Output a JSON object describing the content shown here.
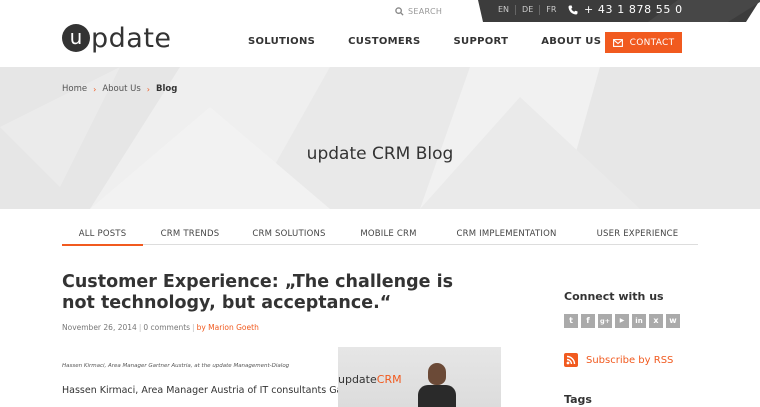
{
  "header": {
    "logo_letter": "u",
    "logo_rest": "pdate",
    "search_label": "SEARCH",
    "languages": [
      "EN",
      "DE",
      "FR"
    ],
    "phone": "+ 43 1 878 55 0",
    "nav": [
      "SOLUTIONS",
      "CUSTOMERS",
      "SUPPORT",
      "ABOUT US"
    ],
    "contact_label": "CONTACT"
  },
  "hero": {
    "breadcrumb": [
      "Home",
      "About Us",
      "Blog"
    ],
    "title": "update CRM Blog"
  },
  "tabs": [
    "ALL POSTS",
    "CRM TRENDS",
    "CRM SOLUTIONS",
    "MOBILE CRM",
    "CRM IMPLEMENTATION",
    "USER EXPERIENCE"
  ],
  "article": {
    "title": "Customer Experience: „The challenge is not technology, but acceptance.“",
    "date": "November 26, 2014",
    "comments": "0 comments",
    "author": "by Marion Goeth",
    "caption": "Hassen Kirmaci, Area Manager Gartner Austria, at the update Management-Dialog",
    "excerpt": "Hassen Kirmaci, Area Manager Austria of IT consultants Gartner,",
    "photo_sign_prefix": "update",
    "photo_sign_suffix": "CRM"
  },
  "sidebar": {
    "connect_title": "Connect with us",
    "social_icons": [
      "twitter-icon",
      "facebook-icon",
      "google-plus-icon",
      "youtube-icon",
      "linkedin-icon",
      "xing-icon",
      "wordpress-icon"
    ],
    "social_glyphs": [
      "t",
      "f",
      "g+",
      "▶",
      "in",
      "x",
      "w"
    ],
    "rss_label": "Subscribe by RSS",
    "tags_title": "Tags"
  },
  "colors": {
    "accent": "#f15a1f",
    "dark": "#333333",
    "hero_bg": "#ececec"
  }
}
